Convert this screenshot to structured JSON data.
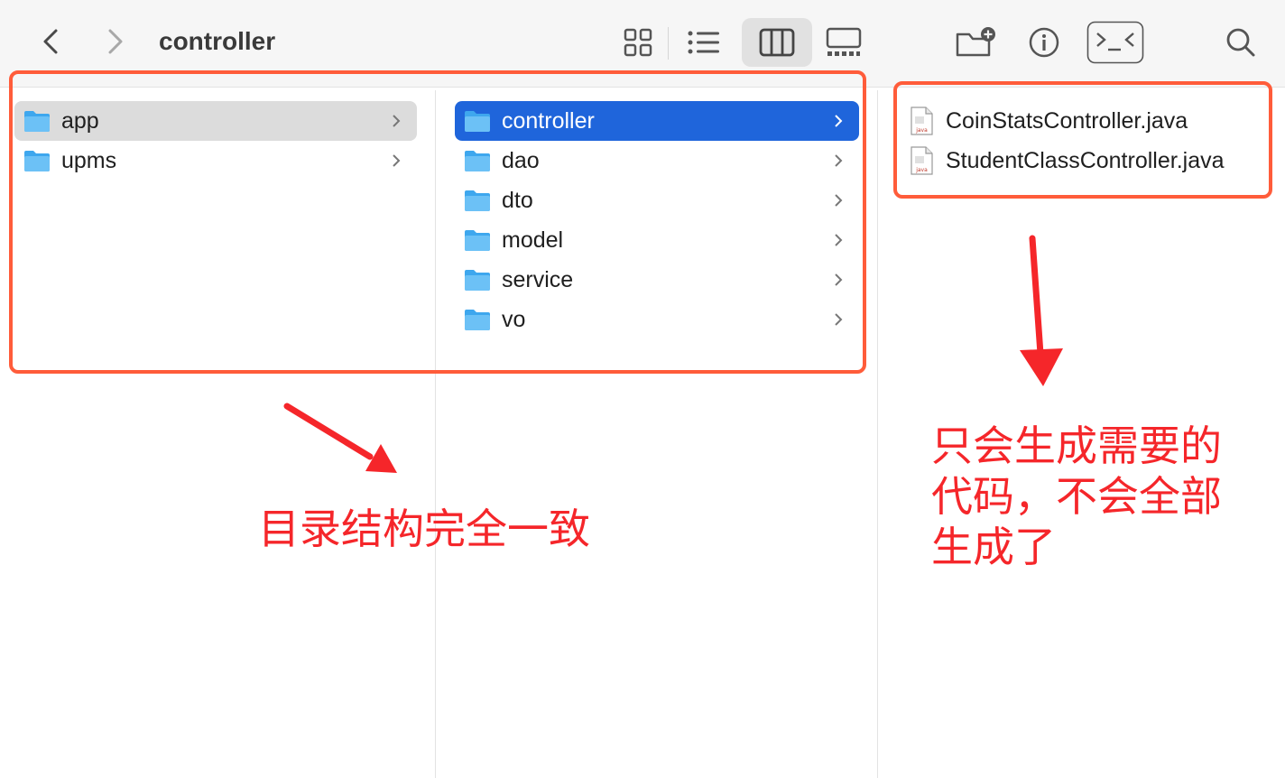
{
  "window": {
    "title": "controller"
  },
  "toolbar": {
    "back": "chevron-left-icon",
    "forward": "chevron-right-icon",
    "views": [
      "icon-view-icon",
      "list-view-icon",
      "column-view-icon",
      "gallery-view-icon"
    ],
    "actions": [
      "new-folder-icon",
      "info-icon",
      "terminal-icon",
      "search-icon"
    ]
  },
  "columns": {
    "first": [
      {
        "name": "app",
        "selected": true
      },
      {
        "name": "upms",
        "selected": false
      }
    ],
    "second": [
      {
        "name": "controller",
        "selected": true
      },
      {
        "name": "dao"
      },
      {
        "name": "dto"
      },
      {
        "name": "model"
      },
      {
        "name": "service"
      },
      {
        "name": "vo"
      }
    ],
    "third": [
      {
        "name": "CoinStatsController.java",
        "badge": "java"
      },
      {
        "name": "StudentClassController.java",
        "badge": "java"
      }
    ]
  },
  "annotations": {
    "left_note": "目录结构完全一致",
    "right_note_lines": [
      "只会生成需要的",
      "代码，不会全部",
      "生成了"
    ],
    "color": "#f5262a"
  },
  "colors": {
    "selection_blue": "#1f65db",
    "selection_gray": "#dcdcdc",
    "folder_blue": "#5bb6f0",
    "highlight_box": "#ff5c3a"
  }
}
